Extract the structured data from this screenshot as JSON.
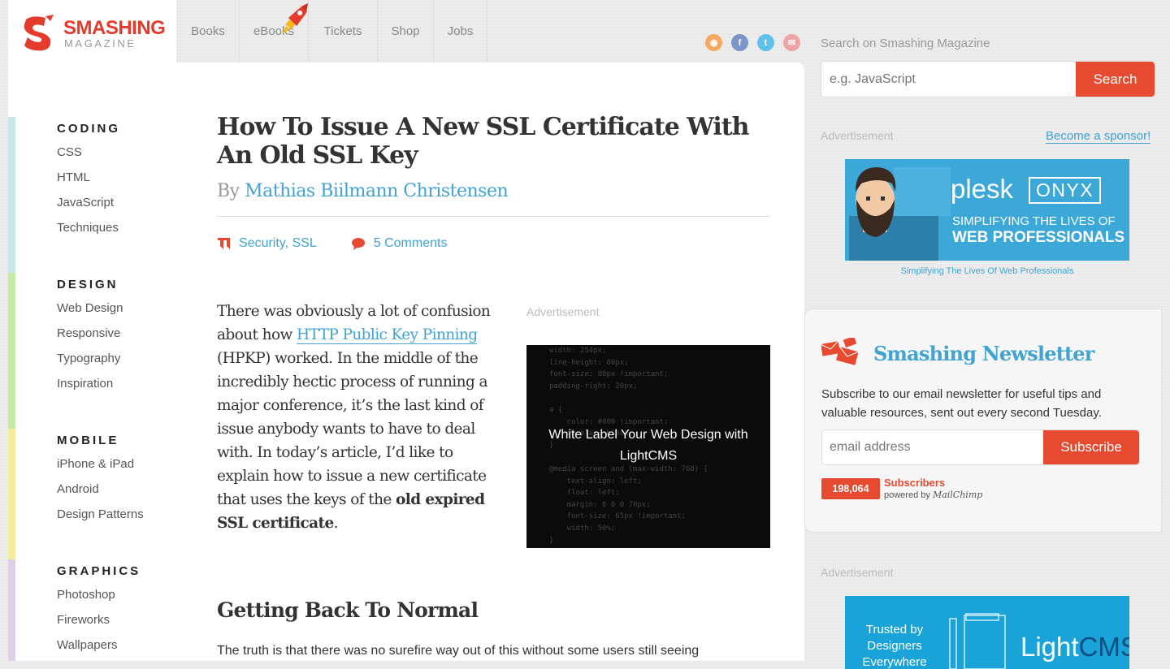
{
  "header": {
    "logo_title": "SMASHING",
    "logo_sub": "MAGAZINE",
    "nav": [
      {
        "label": "Books"
      },
      {
        "label": "eBooks"
      },
      {
        "label": "Tickets"
      },
      {
        "label": "Shop"
      },
      {
        "label": "Jobs"
      }
    ],
    "social_icons": [
      "rss-icon",
      "facebook-icon",
      "twitter-icon",
      "email-icon"
    ]
  },
  "sidebar": {
    "categories": [
      {
        "title": "CODING",
        "color": "#c8e9e5",
        "items": [
          "CSS",
          "HTML",
          "JavaScript",
          "Techniques"
        ]
      },
      {
        "title": "DESIGN",
        "color": "#c9e9a9",
        "items": [
          "Web Design",
          "Responsive",
          "Typography",
          "Inspiration"
        ]
      },
      {
        "title": "MOBILE",
        "color": "#f5ec9b",
        "items": [
          "iPhone & iPad",
          "Android",
          "Design Patterns"
        ]
      },
      {
        "title": "GRAPHICS",
        "color": "#ddd0e6",
        "items": [
          "Photoshop",
          "Fireworks",
          "Wallpapers"
        ]
      }
    ]
  },
  "article": {
    "title": "How To Issue A New SSL Certificate With An Old SSL Key",
    "by": "By",
    "author": "Mathias Biilmann Christensen",
    "tags": "Security, SSL",
    "comments": "5 Comments",
    "intro_1": "There was obviously a lot of confusion about how ",
    "intro_link": "HTTP Public Key Pinning",
    "intro_2": " (HPKP) worked. In the middle of the incredibly hectic process of running a major conference, it’s the last kind of issue anybody wants to have to deal with. In today’s article, I’d like to explain how to issue a new certificate that uses the keys of the ",
    "intro_bold": "old expired SSL certificate",
    "intro_end": ".",
    "ad_label": "Advertisement",
    "inline_ad_text": "White Label Your Web Design with LightCMS",
    "inline_ad_code": "width: 254px;\nline-height: 80px;\nfont-size: 80px !important;\npadding-right: 20px;\n\na {\n    color: #000 !important;\n    display: block;\n}\n\n@media screen and (max-width: 768) {\n    text-align: left;\n    float: left;\n    margin: 0 0 0 70px;\n    font-size: 65px !important;\n    width: 50%;\n}\n}",
    "section_heading": "Getting Back To Normal",
    "section_para": "The truth is that there was no surefire way out of this without some users still seeing"
  },
  "search": {
    "label": "Search on Smashing Magazine",
    "placeholder": "e.g. JavaScript",
    "button": "Search"
  },
  "ads": {
    "label": "Advertisement",
    "sponsor_link": "Become a sponsor!",
    "plesk_brand": "plesk",
    "plesk_product": "ONYX",
    "plesk_line1": "SIMPLIFYING THE LIVES OF",
    "plesk_line2": "WEB PROFESSIONALS",
    "plesk_caption": "Simplifying The Lives Of Web Professionals",
    "lightcms_line1": "Trusted by",
    "lightcms_line2": "Designers",
    "lightcms_line3": "Everywhere",
    "lightcms_brand_a": "Light",
    "lightcms_brand_b": "CMS"
  },
  "newsletter": {
    "title": "Smashing Newsletter",
    "description": "Subscribe to our email newsletter for useful tips and valuable resources, sent out every second Tuesday.",
    "placeholder": "email address",
    "button": "Subscribe",
    "count": "198,064",
    "subscribers_label": "Subscribers",
    "powered_by": "powered by",
    "provider": "MailChimp"
  },
  "colors": {
    "accent": "#e64b31",
    "link": "#41a3d2"
  }
}
